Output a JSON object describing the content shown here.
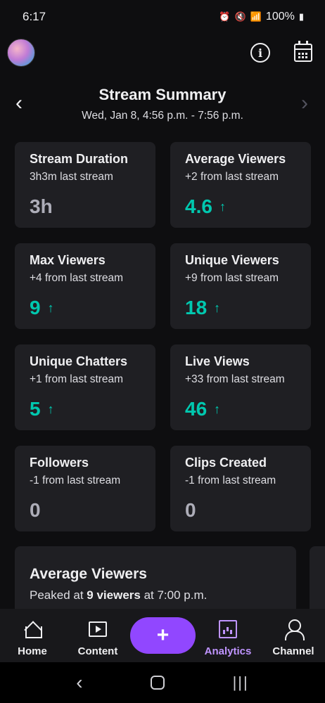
{
  "status_bar": {
    "time": "6:17",
    "battery": "100%"
  },
  "header": {
    "title": "Stream Summary",
    "subtitle": "Wed, Jan 8, 4:56 p.m. - 7:56 p.m."
  },
  "cards": [
    {
      "title": "Stream Duration",
      "sub": "3h3m last stream",
      "value": "3h",
      "trend": "flat"
    },
    {
      "title": "Average Viewers",
      "sub": "+2 from last stream",
      "value": "4.6",
      "trend": "up"
    },
    {
      "title": "Max Viewers",
      "sub": "+4 from last stream",
      "value": "9",
      "trend": "up"
    },
    {
      "title": "Unique Viewers",
      "sub": "+9 from last stream",
      "value": "18",
      "trend": "up"
    },
    {
      "title": "Unique Chatters",
      "sub": "+1 from last stream",
      "value": "5",
      "trend": "up"
    },
    {
      "title": "Live Views",
      "sub": "+33 from last stream",
      "value": "46",
      "trend": "up"
    },
    {
      "title": "Followers",
      "sub": "-1 from last stream",
      "value": "0",
      "trend": "flat"
    },
    {
      "title": "Clips Created",
      "sub": "-1 from last stream",
      "value": "0",
      "trend": "flat"
    }
  ],
  "avg_panel": {
    "title": "Average Viewers",
    "sub_prefix": "Peaked at ",
    "sub_bold": "9 viewers",
    "sub_suffix": " at 7:00 p.m."
  },
  "bottom_nav": {
    "home": "Home",
    "content": "Content",
    "add": "+",
    "analytics": "Analytics",
    "channel": "Channel"
  },
  "colors": {
    "accent_teal": "#00c8af",
    "accent_purple": "#9147ff",
    "active_nav": "#bf94ff"
  }
}
